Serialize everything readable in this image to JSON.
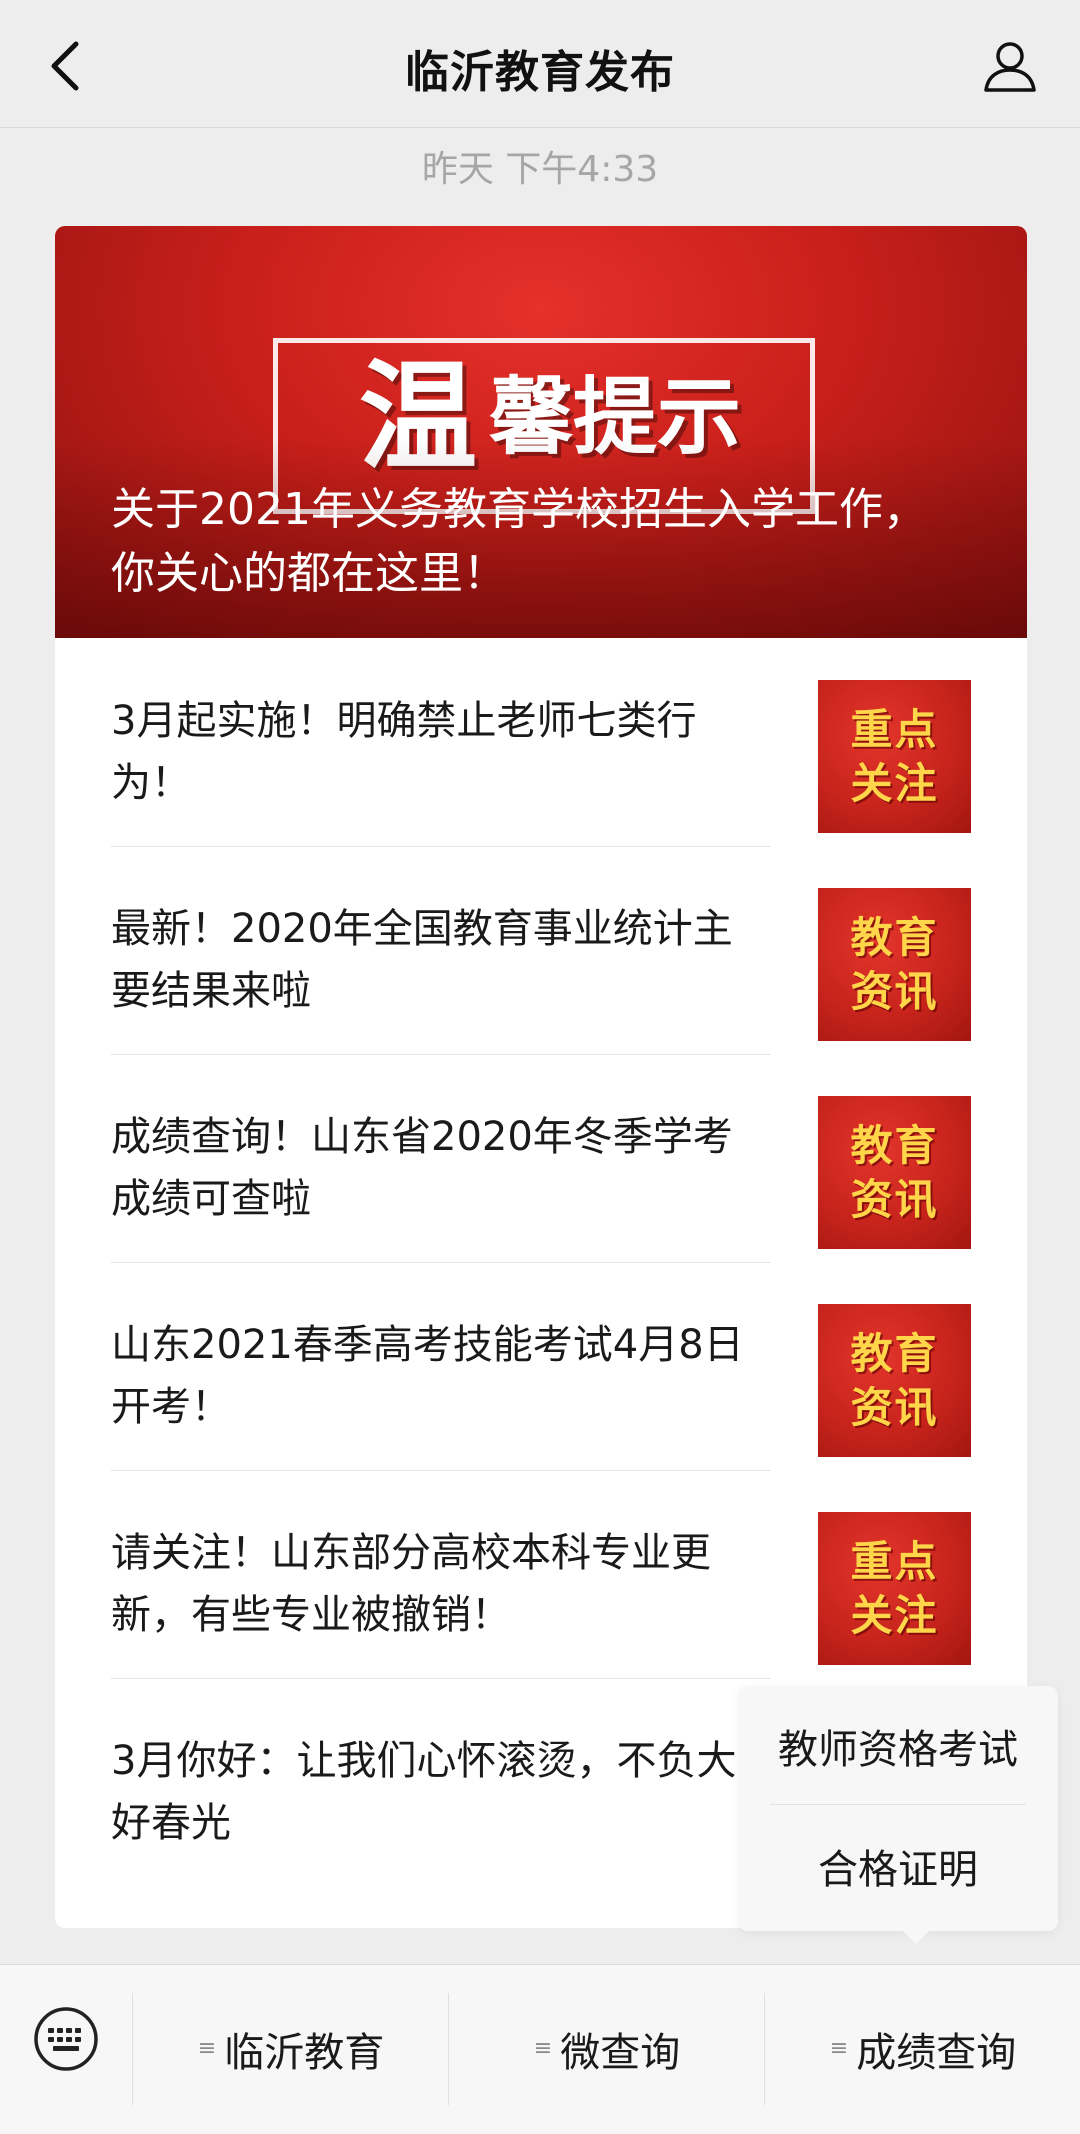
{
  "header": {
    "title": "临沂教育发布",
    "back_icon": "chevron-left-icon",
    "profile_icon": "person-icon"
  },
  "timestamp": "昨天 下午4:33",
  "hero": {
    "banner_big": "温",
    "banner_rest": "馨提示",
    "title": "关于2021年义务教育学校招生入学工作，你关心的都在这里！",
    "color": "#c81f1a"
  },
  "articles": [
    {
      "title": "3月起实施！明确禁止老师七类行为！",
      "thumb": [
        "重点",
        "关注"
      ]
    },
    {
      "title": "最新！2020年全国教育事业统计主要结果来啦",
      "thumb": [
        "教育",
        "资讯"
      ]
    },
    {
      "title": "成绩查询！山东省2020年冬季学考成绩可查啦",
      "thumb": [
        "教育",
        "资讯"
      ]
    },
    {
      "title": "山东2021春季高考技能考试4月8日开考！",
      "thumb": [
        "教育",
        "资讯"
      ]
    },
    {
      "title": "请关注！山东部分高校本科专业更新，有些专业被撤销！",
      "thumb": [
        "重点",
        "关注"
      ]
    },
    {
      "title": "3月你好：让我们心怀滚烫，不负大好春光",
      "thumb": []
    }
  ],
  "popup": {
    "items": [
      "教师资格考试",
      "合格证明"
    ]
  },
  "menubar": {
    "keyboard_icon": "keyboard-icon",
    "items": [
      "临沂教育",
      "微查询",
      "成绩查询"
    ],
    "menu_glyph": "≡"
  },
  "colors": {
    "accent_red": "#c7241c",
    "thumb_text": "#ffd54a",
    "background": "#ededed"
  }
}
